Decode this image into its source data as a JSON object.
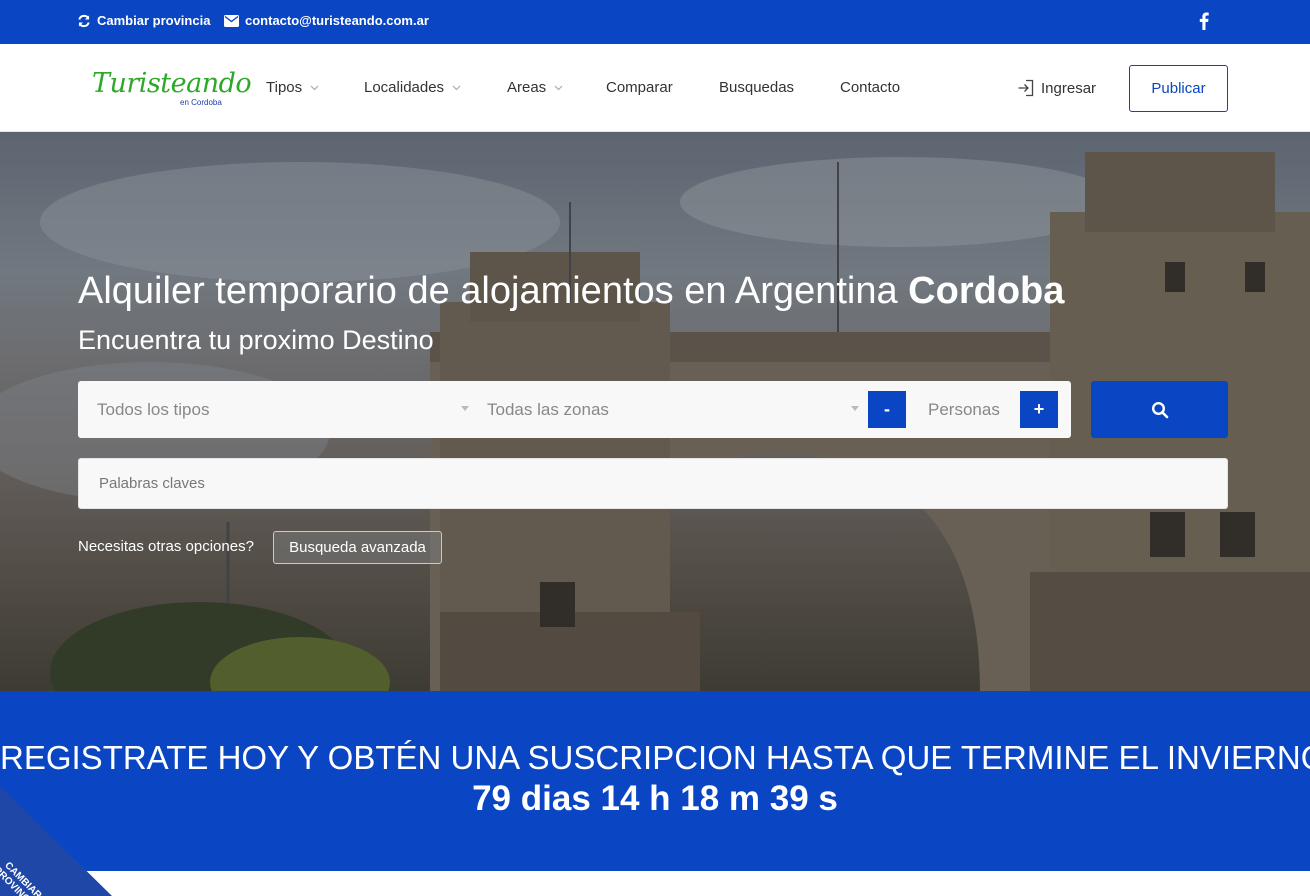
{
  "topbar": {
    "change_province": "Cambiar provincia",
    "email": "contacto@turisteando.com.ar",
    "social_icon": "facebook-icon"
  },
  "header": {
    "logo_main": "Turisteando",
    "logo_sub": "en Cordoba",
    "nav": [
      {
        "label": "Tipos",
        "dropdown": true
      },
      {
        "label": "Localidades",
        "dropdown": true
      },
      {
        "label": "Areas",
        "dropdown": true
      },
      {
        "label": "Comparar",
        "dropdown": false
      },
      {
        "label": "Busquedas",
        "dropdown": false
      },
      {
        "label": "Contacto",
        "dropdown": false
      }
    ],
    "login": "Ingresar",
    "publish": "Publicar"
  },
  "hero": {
    "title_prefix": "Alquiler temporario de alojamientos en Argentina",
    "title_bold": "Cordoba",
    "subtitle": "Encuentra tu proximo Destino",
    "type_select": "Todos los tipos",
    "zone_select": "Todas las zonas",
    "minus": "-",
    "persons": "Personas",
    "plus": "+",
    "keywords_placeholder": "Palabras claves",
    "more_options": "Necesitas otras opciones?",
    "advanced_search": "Busqueda avanzada"
  },
  "promo": {
    "headline": "REGISTRATE HOY Y OBTÉN UNA SUSCRIPCION HASTA QUE TERMINE EL INVIERNO",
    "countdown": "79 dias 14 h 18 m 39 s"
  },
  "corner": {
    "line1": "CAMBIAR",
    "line2": "PROVINCIA"
  },
  "colors": {
    "brand_blue": "#0a46c3",
    "logo_green": "#2ea82a"
  }
}
